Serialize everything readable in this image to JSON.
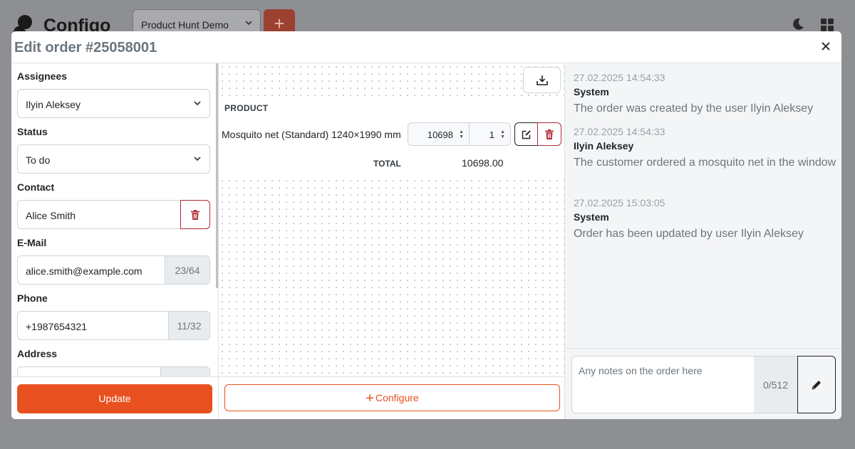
{
  "app": {
    "brand": "Configo",
    "project_select": "Product Hunt Demo",
    "add_label": "+"
  },
  "modal": {
    "title": "Edit order #25058001"
  },
  "form": {
    "assignees_label": "Assignees",
    "assignees_value": "Ilyin Aleksey",
    "status_label": "Status",
    "status_value": "To do",
    "contact_label": "Contact",
    "contact_value": "Alice Smith",
    "email_label": "E-Mail",
    "email_value": "alice.smith@example.com",
    "email_counter": "23/64",
    "phone_label": "Phone",
    "phone_value": "+1987654321",
    "phone_counter": "11/32",
    "address_label": "Address",
    "update_label": "Update"
  },
  "products": {
    "header": "PRODUCT",
    "rows": [
      {
        "name": "Mosquito net (Standard) 1240×1990 mm",
        "price": "10698",
        "qty": "1"
      }
    ],
    "total_label": "TOTAL",
    "total_value": "10698.00",
    "configure_label": "Configure"
  },
  "log": [
    {
      "time": "27.02.2025 14:54:33",
      "user": "System",
      "message": "The order was created by the user Ilyin Aleksey"
    },
    {
      "time": "27.02.2025 14:54:33",
      "user": "Ilyin Aleksey",
      "message": "The customer ordered a mosquito net in the window"
    },
    {
      "time": "27.02.2025 15:03:05",
      "user": "System",
      "message": "Order has been updated by user Ilyin Aleksey"
    }
  ],
  "notes": {
    "placeholder": "Any notes on the order here",
    "counter": "0/512"
  },
  "colors": {
    "accent": "#e9501f",
    "danger": "#b02a37"
  }
}
